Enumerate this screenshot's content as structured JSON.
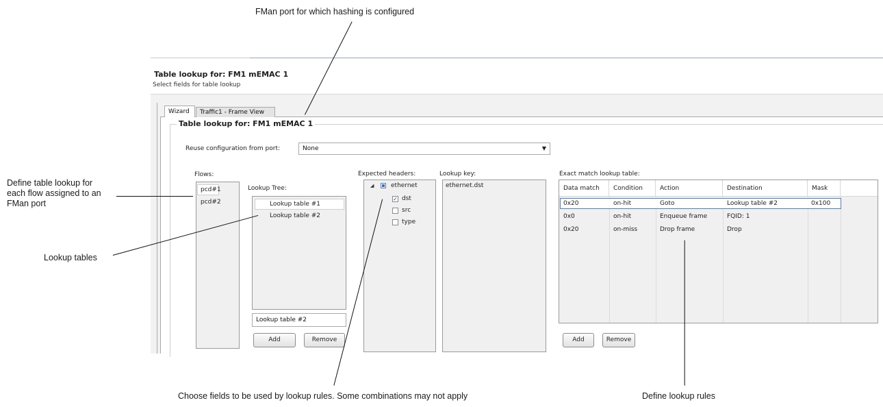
{
  "callouts": {
    "fman_port": "FMan port for which hashing is configured",
    "define_table": "Define table lookup for each flow assigned to an FMan port",
    "lookup_tables": "Lookup tables",
    "choose_fields": "Choose fields to be used by lookup rules. Some combinations may not apply",
    "define_rules": "Define lookup rules"
  },
  "header": {
    "title": "Table lookup for: FM1 mEMAC 1",
    "subtitle": "Select fields for table lookup"
  },
  "tabs": [
    {
      "label": "Wizard",
      "active": true
    },
    {
      "label": "Traffic1 - Frame View",
      "active": false
    }
  ],
  "group": {
    "title": "Table lookup for: FM1 mEMAC 1",
    "reuse_label": "Reuse configuration from port:",
    "reuse_value": "None"
  },
  "flows": {
    "label": "Flows:",
    "items": [
      "pcd#1",
      "pcd#2"
    ]
  },
  "lookup_tree": {
    "label": "Lookup Tree:",
    "items": [
      "Lookup table #1",
      "Lookup table #2"
    ],
    "selected_name": "Lookup table #2",
    "add_label": "Add",
    "remove_label": "Remove"
  },
  "expected_headers": {
    "label": "Expected headers:",
    "root": "ethernet",
    "fields": [
      {
        "name": "dst",
        "checked": true
      },
      {
        "name": "src",
        "checked": false
      },
      {
        "name": "type",
        "checked": false
      }
    ]
  },
  "lookup_key": {
    "label": "Lookup key:",
    "value": "ethernet.dst"
  },
  "exact_match": {
    "label": "Exact match lookup table:",
    "columns": [
      "Data match",
      "Condition",
      "Action",
      "Destination",
      "Mask"
    ],
    "rows": [
      [
        "0x20",
        "on-hit",
        "Goto",
        "Lookup table #2",
        "0x100"
      ],
      [
        "0x0",
        "on-hit",
        "Enqueue frame",
        "FQID: 1",
        ""
      ],
      [
        "0x20",
        "on-miss",
        "Drop frame",
        "Drop",
        ""
      ]
    ],
    "add_label": "Add",
    "remove_label": "Remove"
  },
  "colors": {
    "selection_border": "#4a7fc1",
    "checkbox_check": "#1b4fa0"
  }
}
